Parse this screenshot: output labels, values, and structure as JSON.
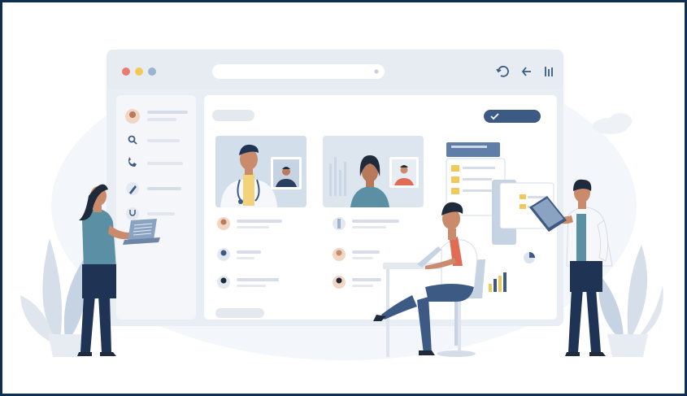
{
  "illustration": {
    "theme": "telehealth video consultation platform",
    "colors": {
      "frame_border": "#0e2f52",
      "browser_chrome": "#e7ecf3",
      "panel": "#f4f6fa",
      "accent_navy": "#3c5a84",
      "skin": "#c98b6b",
      "teal_shirt": "#5b8fa3",
      "pants": "#1f3354",
      "white_coat": "#f5f7fa",
      "red_shirt": "#e06c55",
      "plant": "#cfd8e4"
    },
    "window_controls": [
      "close-dot",
      "minimize-dot",
      "maximize-dot"
    ],
    "toolbar_icons": [
      "refresh-icon",
      "back-arrow-icon",
      "menu-icon"
    ],
    "sidebar_icons": [
      "avatar-icon",
      "search-icon",
      "phone-icon",
      "pen-icon",
      "stethoscope-icon"
    ]
  }
}
